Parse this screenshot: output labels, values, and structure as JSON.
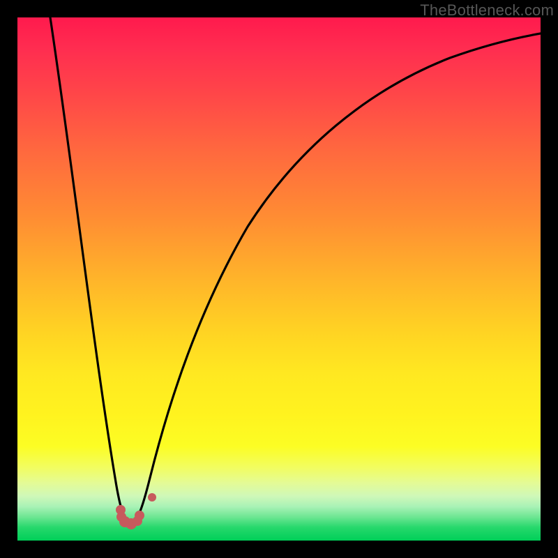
{
  "watermark": "TheBottleneck.com",
  "colors": {
    "page_bg": "#000000",
    "curve_stroke": "#000000",
    "valley_dot": "#c75a5d",
    "gradient_top": "#ff1a4d",
    "gradient_bottom": "#00cf58",
    "watermark_text": "#575757"
  },
  "chart_data": {
    "type": "line",
    "title": "",
    "xlabel": "",
    "ylabel": "",
    "xlim": [
      0,
      100
    ],
    "ylim": [
      0,
      100
    ],
    "grid": false,
    "legend": false,
    "series": [
      {
        "name": "bottleneck-curve",
        "x": [
          6,
          8,
          10,
          12,
          14,
          16,
          18,
          19,
          20,
          21,
          22,
          24,
          26,
          30,
          35,
          40,
          45,
          50,
          55,
          60,
          65,
          70,
          75,
          80,
          85,
          90,
          95,
          100
        ],
        "values": [
          100,
          87,
          74,
          62,
          48,
          33,
          16,
          9,
          4,
          3,
          4,
          9,
          16,
          30,
          44,
          55,
          63,
          70,
          76,
          80,
          84,
          87,
          90,
          92,
          94,
          95,
          96,
          97
        ]
      }
    ],
    "annotations": [
      {
        "type": "marker-cluster",
        "name": "valley-dots",
        "approx_x": 21,
        "approx_y": 3,
        "color": "#c75a5d"
      }
    ],
    "background": {
      "type": "vertical-gradient",
      "stops": [
        {
          "pos": 0.0,
          "color": "#ff1a4d"
        },
        {
          "pos": 0.5,
          "color": "#ffb42a"
        },
        {
          "pos": 0.8,
          "color": "#fff31f"
        },
        {
          "pos": 1.0,
          "color": "#00cf58"
        }
      ]
    }
  }
}
